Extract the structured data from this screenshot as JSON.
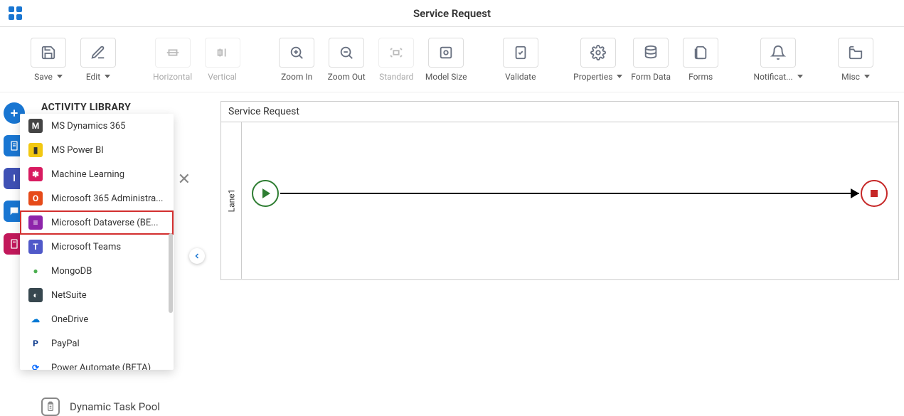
{
  "header": {
    "title": "Service Request"
  },
  "toolbar": {
    "save": "Save",
    "edit": "Edit",
    "horizontal": "Horizontal",
    "vertical": "Vertical",
    "zoomIn": "Zoom In",
    "zoomOut": "Zoom Out",
    "standard": "Standard",
    "modelSize": "Model Size",
    "validate": "Validate",
    "properties": "Properties",
    "formData": "Form Data",
    "forms": "Forms",
    "notifications": "Notificat...",
    "misc": "Misc"
  },
  "sidebar": {
    "heading": "ACTIVITY LIBRARY",
    "dynamicPool": "Dynamic Task Pool"
  },
  "dropdown": {
    "items": [
      {
        "label": "MS Dynamics 365",
        "iconBg": "#444",
        "iconColor": "#fff",
        "glyph": "M"
      },
      {
        "label": "MS Power BI",
        "iconBg": "#f2c811",
        "iconColor": "#333",
        "glyph": "▮"
      },
      {
        "label": "Machine Learning",
        "iconBg": "#d81b60",
        "iconColor": "#fff",
        "glyph": "✱"
      },
      {
        "label": "Microsoft 365 Administra...",
        "iconBg": "#e64a19",
        "iconColor": "#fff",
        "glyph": "O"
      },
      {
        "label": "Microsoft Dataverse (BE...",
        "iconBg": "#8e24aa",
        "iconColor": "#fff",
        "glyph": "≡",
        "highlighted": true
      },
      {
        "label": "Microsoft Teams",
        "iconBg": "#5059c9",
        "iconColor": "#fff",
        "glyph": "T"
      },
      {
        "label": "MongoDB",
        "iconBg": "#fff",
        "iconColor": "#4caf50",
        "glyph": "●"
      },
      {
        "label": "NetSuite",
        "iconBg": "#37474f",
        "iconColor": "#fff",
        "glyph": "◐"
      },
      {
        "label": "OneDrive",
        "iconBg": "#fff",
        "iconColor": "#0078d4",
        "glyph": "☁"
      },
      {
        "label": "PayPal",
        "iconBg": "#fff",
        "iconColor": "#003087",
        "glyph": "P"
      },
      {
        "label": "Power Automate (BETA)",
        "iconBg": "#fff",
        "iconColor": "#0066ff",
        "glyph": "⟳"
      }
    ]
  },
  "canvas": {
    "title": "Service Request",
    "laneLabel": "Lane1"
  },
  "closeGlyph": "✕"
}
